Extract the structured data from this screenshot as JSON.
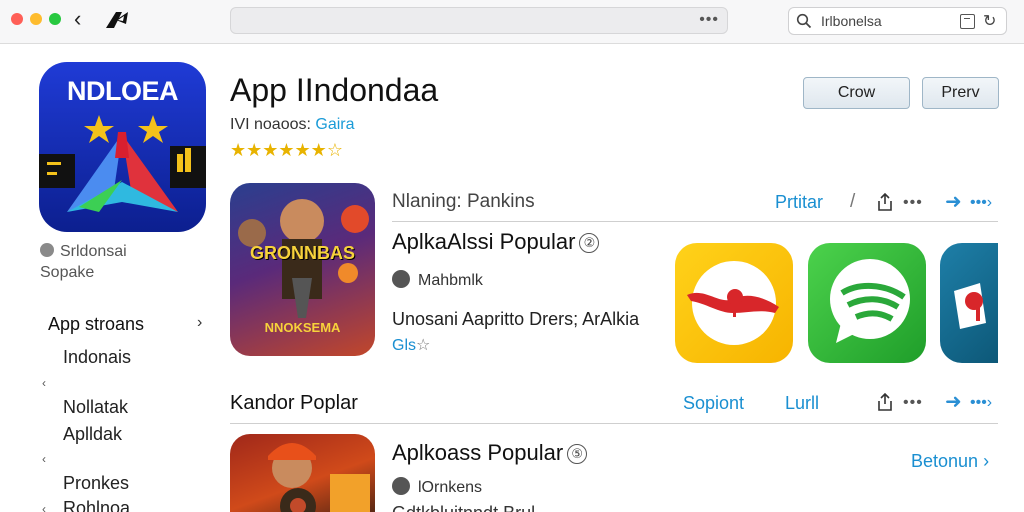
{
  "browser": {
    "search_text": "Irlbonelsa"
  },
  "app": {
    "icon_text": "NDLOEA",
    "title": "App IIndondaa",
    "subtitle_prefix": "IVI noaoos: ",
    "subtitle_category": "Gaira",
    "rating_stars": "★★★★★★☆",
    "btn_primary": "Crow",
    "btn_secondary": "Prerv"
  },
  "sidebar": {
    "developer_line1": "Srldonsai",
    "developer_line2": "Sopake",
    "heading": "App stroans",
    "heading_chevron": "›",
    "items": [
      {
        "label": "Indonais",
        "mark": ""
      },
      {
        "label": "Nollatak",
        "mark": "‹"
      },
      {
        "label": "Aplldak",
        "mark": ""
      },
      {
        "label": "Pronkes",
        "mark": "‹"
      },
      {
        "label": "Rohlnoa",
        "mark": "‹"
      }
    ]
  },
  "section1": {
    "label": "Nlaning: Pankins",
    "link1": "Prtitar",
    "slash": "/",
    "card_title": "AplkaAlssi Popular",
    "card_info": "②",
    "meta": "Mahbmlk",
    "description": "Unosani Aapritto Drers; ArAlkia",
    "rating_prefix": "Gls",
    "rating_star": "☆",
    "thumb_text": "GRONNBAS",
    "thumb_text2": "NNOKSEMA"
  },
  "section2": {
    "label": "Kandor Poplar",
    "link1": "Sopiont",
    "link2": "Lurll",
    "card_title": "Aplkoass Popular",
    "card_info": "⑤",
    "meta": "lOrnkens",
    "link_right": "Betonun",
    "desc_partial": "Gdtkbluitnndt Brul"
  },
  "colors": {
    "accent_blue": "#1a8fd1",
    "star_yellow": "#e8b300",
    "icon_blue": "#1f3bd6"
  }
}
